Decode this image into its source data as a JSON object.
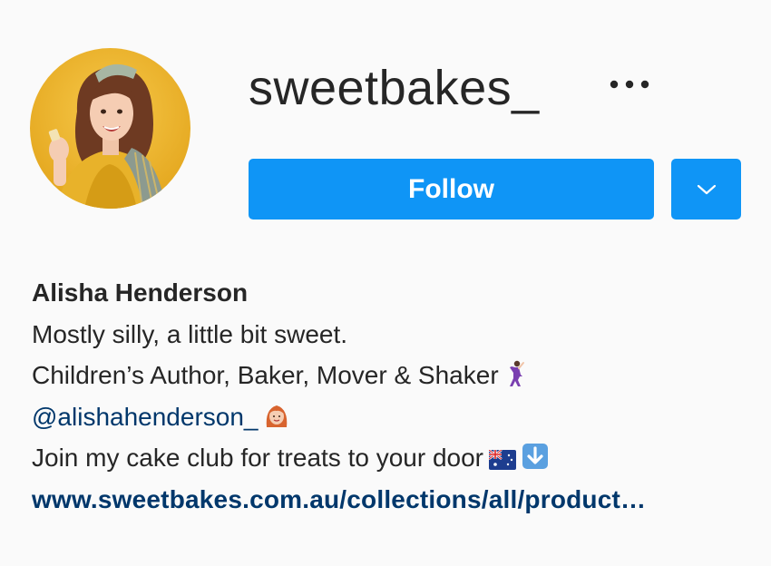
{
  "profile": {
    "username": "sweetbakes_",
    "more_icon": "more-horizontal-icon",
    "avatar_icon": "profile-photo"
  },
  "actions": {
    "follow_label": "Follow",
    "dropdown_icon": "chevron-down-icon",
    "accent_color": "#0f95f6"
  },
  "bio": {
    "full_name": "Alisha Henderson",
    "line1": "Mostly silly, a little bit sweet.",
    "line2": "Children’s Author, Baker, Mover & Shaker",
    "line2_emoji": "dancing-woman-emoji",
    "mention": "@alishahenderson_",
    "mention_emoji": "red-haired-woman-emoji",
    "line4": "Join my cake club for treats to your door",
    "line4_emojis": [
      "australia-flag-emoji",
      "down-arrow-emoji"
    ],
    "link": "www.sweetbakes.com.au/collections/all/product…",
    "link_color": "#00376b"
  }
}
